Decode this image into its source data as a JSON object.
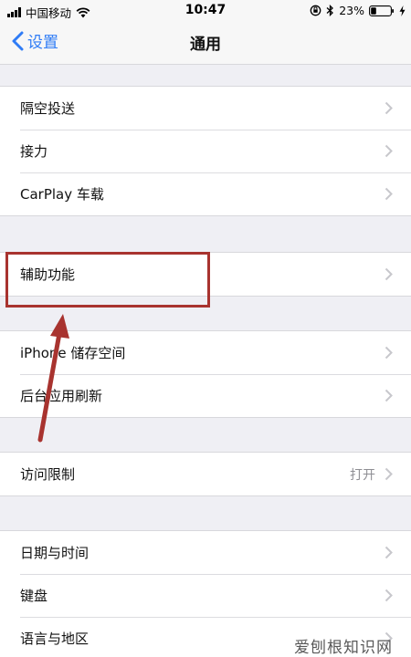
{
  "status_bar": {
    "carrier": "中国移动",
    "time": "10:47",
    "battery_percent": "23%"
  },
  "nav": {
    "back_label": "设置",
    "title": "通用"
  },
  "groups": [
    {
      "rows": [
        {
          "label": "隔空投送"
        },
        {
          "label": "接力"
        },
        {
          "label": "CarPlay 车载"
        }
      ]
    },
    {
      "rows": [
        {
          "label": "辅助功能"
        }
      ]
    },
    {
      "rows": [
        {
          "label": "iPhone 储存空间"
        },
        {
          "label": "后台应用刷新"
        }
      ]
    },
    {
      "rows": [
        {
          "label": "访问限制",
          "value": "打开"
        }
      ]
    },
    {
      "rows": [
        {
          "label": "日期与时间"
        },
        {
          "label": "键盘"
        },
        {
          "label": "语言与地区"
        }
      ]
    }
  ],
  "watermark": "爱刨根知识网",
  "colors": {
    "accent": "#2f7cf6",
    "annotation": "#a8332f",
    "background": "#efeff4"
  }
}
